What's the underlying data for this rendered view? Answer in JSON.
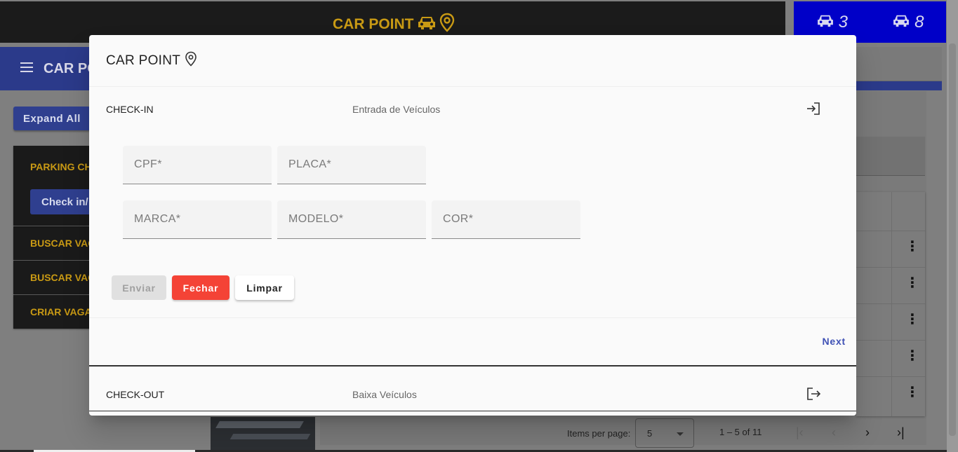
{
  "app": {
    "brand": "CAR POINT",
    "counters": [
      {
        "icon": "car-icon",
        "value": "3"
      },
      {
        "icon": "car-icon",
        "value": "8"
      }
    ],
    "toolbar_title": "CAR PO"
  },
  "sidebar": {
    "expand_all": "Expand All",
    "panels": [
      {
        "title": "PARKING CH",
        "button": "Check in/"
      },
      {
        "title": "BUSCAR VAG"
      },
      {
        "title": "BUSCAR VAG"
      },
      {
        "title": "CRIAR VAGA"
      }
    ]
  },
  "paginator": {
    "items_per_page_label": "Items per page:",
    "page_size": "5",
    "range": "1 – 5 of 11"
  },
  "dialog": {
    "title": "CAR POINT",
    "steps": [
      {
        "title": "CHECK-IN",
        "description": "Entrada de Veículos",
        "icon": "login-icon"
      },
      {
        "title": "CHECK-OUT",
        "description": "Baixa Veículos",
        "icon": "logout-icon"
      }
    ],
    "fields": {
      "cpf": "CPF*",
      "placa": "PLACA*",
      "marca": "MARCA*",
      "modelo": "MODELO*",
      "cor": "COR*"
    },
    "buttons": {
      "enviar": "Enviar",
      "fechar": "Fechar",
      "limpar": "Limpar",
      "next": "Next"
    }
  },
  "colors": {
    "brand_gold": "#c99a14",
    "counter_blue": "#0000c8",
    "primary": "#3f51b5",
    "warn": "#f44336"
  }
}
